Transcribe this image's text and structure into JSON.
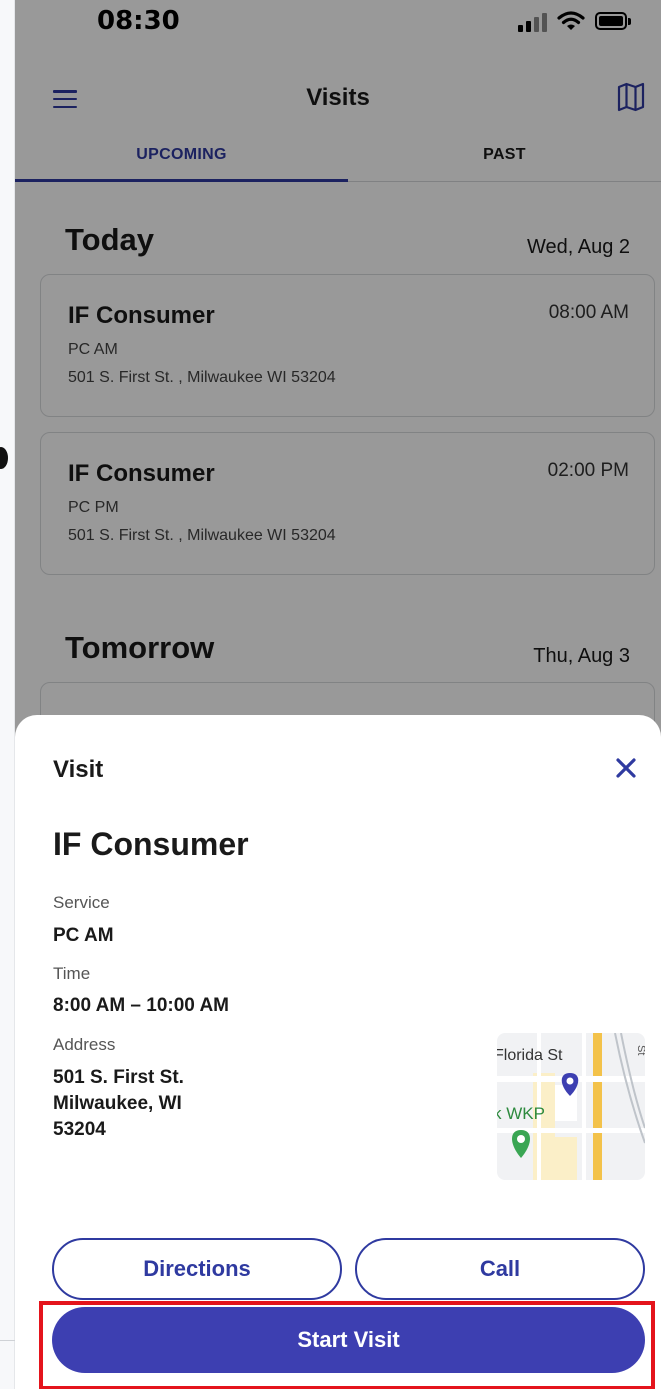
{
  "status_bar": {
    "time": "08:30"
  },
  "header": {
    "title": "Visits",
    "menu_icon": "menu-icon",
    "map_icon": "map-icon"
  },
  "tabs": [
    {
      "label": "UPCOMING",
      "active": true
    },
    {
      "label": "PAST",
      "active": false
    }
  ],
  "sections": [
    {
      "title": "Today",
      "date": "Wed, Aug 2",
      "visits": [
        {
          "consumer": "IF Consumer",
          "time": "08:00 AM",
          "service": "PC AM",
          "address": "501 S. First St. , Milwaukee WI 53204"
        },
        {
          "consumer": "IF Consumer",
          "time": "02:00 PM",
          "service": "PC PM",
          "address": "501 S. First St. , Milwaukee WI 53204"
        }
      ]
    },
    {
      "title": "Tomorrow",
      "date": "Thu, Aug 3",
      "visits": []
    }
  ],
  "sheet": {
    "title": "Visit",
    "consumer": "IF Consumer",
    "service_label": "Service",
    "service_value": "PC AM",
    "time_label": "Time",
    "time_value": "8:00 AM – 10:00 AM",
    "address_label": "Address",
    "address_line1": "501 S. First St.",
    "address_line2": "Milwaukee, WI",
    "address_line3": "53204",
    "map": {
      "street_label": "Florida St",
      "place_label": "k WKP",
      "corner_label": "St"
    },
    "directions_label": "Directions",
    "call_label": "Call",
    "start_label": "Start Visit"
  },
  "colors": {
    "accent": "#2f3aa0",
    "primary_button": "#3d3fb1",
    "highlight": "#e4141c",
    "overlay": "rgba(0,0,0,0.4)"
  }
}
